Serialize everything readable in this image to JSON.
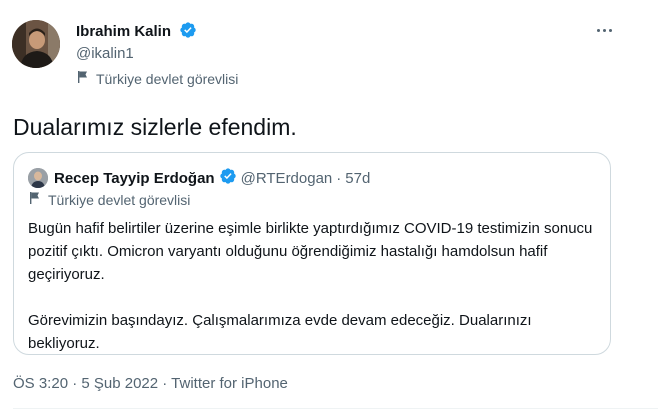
{
  "author": {
    "name": "Ibrahim Kalin",
    "handle": "@ikalin1",
    "label": "Türkiye devlet görevlisi"
  },
  "tweet_text": "Dualarımız sizlerle efendim.",
  "quoted": {
    "name": "Recep Tayyip Erdoğan",
    "handle": "@RTErdogan",
    "separator": "·",
    "time": "57d",
    "label": "Türkiye devlet görevlisi",
    "paragraph1": "Bugün hafif belirtiler üzerine eşimle birlikte yaptırdığımız COVID-19 testimizin sonucu pozitif çıktı. Omicron varyantı olduğunu öğrendiğimiz hastalığı hamdolsun hafif geçiriyoruz.",
    "paragraph2": "Görevimizin başındayız. Çalışmalarımıza evde devam edeceğiz. Dualarınızı bekliyoruz."
  },
  "meta": "ÖS 3:20 · 5 Şub 2022 · Twitter for iPhone",
  "colors": {
    "verified": "#1d9bf0",
    "secondary_text": "#536471",
    "border": "#cfd9de"
  },
  "icons": [
    "verified-badge-icon",
    "flag-icon",
    "more-options-icon"
  ]
}
